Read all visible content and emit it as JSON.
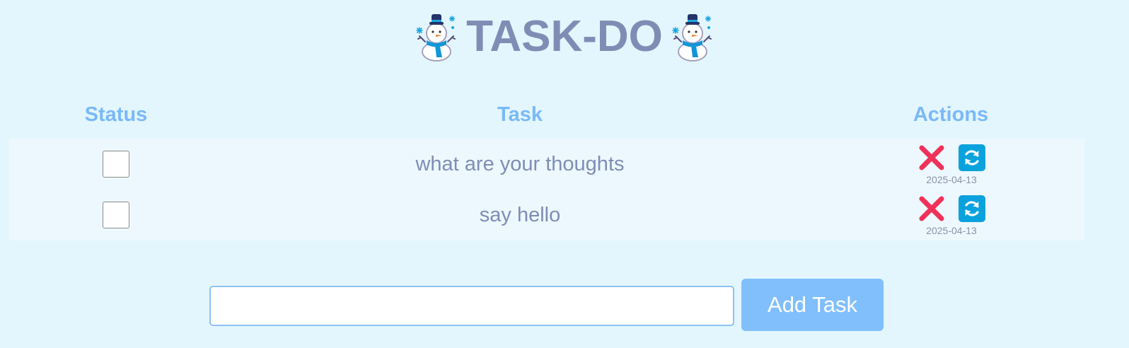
{
  "app": {
    "title": "TASK-DO"
  },
  "table": {
    "headers": {
      "status": "Status",
      "task": "Task",
      "actions": "Actions"
    },
    "rows": [
      {
        "checked": false,
        "task": "what are your thoughts",
        "date": "2025-04-13"
      },
      {
        "checked": false,
        "task": "say hello",
        "date": "2025-04-13"
      }
    ]
  },
  "form": {
    "input_value": "",
    "add_label": "Add Task"
  },
  "icons": {
    "decor": "snowman-icon",
    "delete": "close-icon",
    "update": "refresh-icon"
  },
  "colors": {
    "background": "#e3f6fe",
    "title": "#7f8db5",
    "header": "#7ab9f7",
    "delete": "#f0325a",
    "update": "#0aa2dd",
    "add_button": "#80bffc"
  }
}
